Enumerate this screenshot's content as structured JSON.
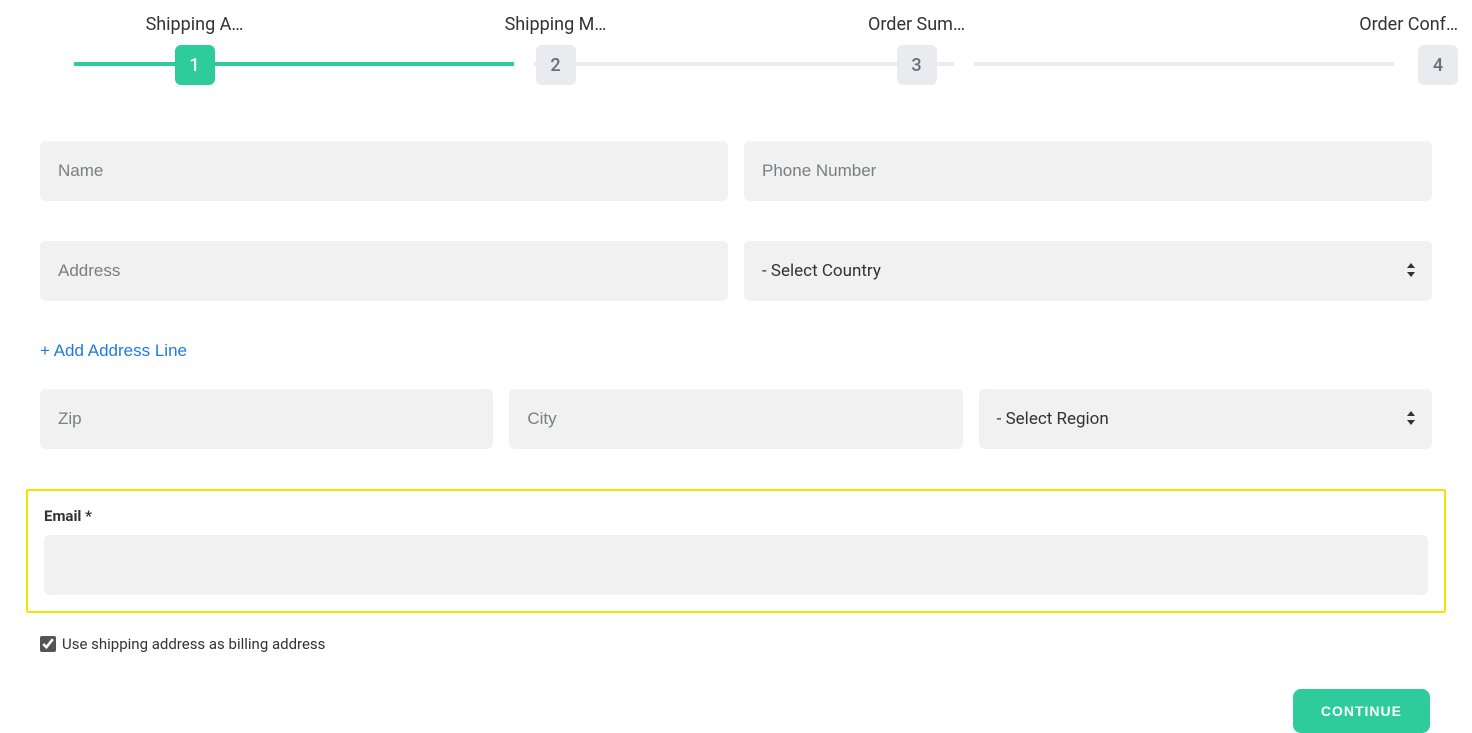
{
  "stepper": {
    "steps": [
      {
        "label": "Shipping A…",
        "num": "1",
        "active": true
      },
      {
        "label": "Shipping M…",
        "num": "2",
        "active": false
      },
      {
        "label": "Order Sum…",
        "num": "3",
        "active": false
      },
      {
        "label": "Order Conf…",
        "num": "4",
        "active": false
      }
    ]
  },
  "form": {
    "name_placeholder": "Name",
    "phone_placeholder": "Phone Number",
    "address_placeholder": "Address",
    "country_placeholder": " - Select Country",
    "add_address_label": "+ Add Address Line",
    "zip_placeholder": "Zip",
    "city_placeholder": "City",
    "region_placeholder": " - Select Region",
    "email_label": "Email *",
    "billing_checkbox_label": "Use shipping address as billing address",
    "billing_checked": true,
    "continue_label": "CONTINUE"
  }
}
